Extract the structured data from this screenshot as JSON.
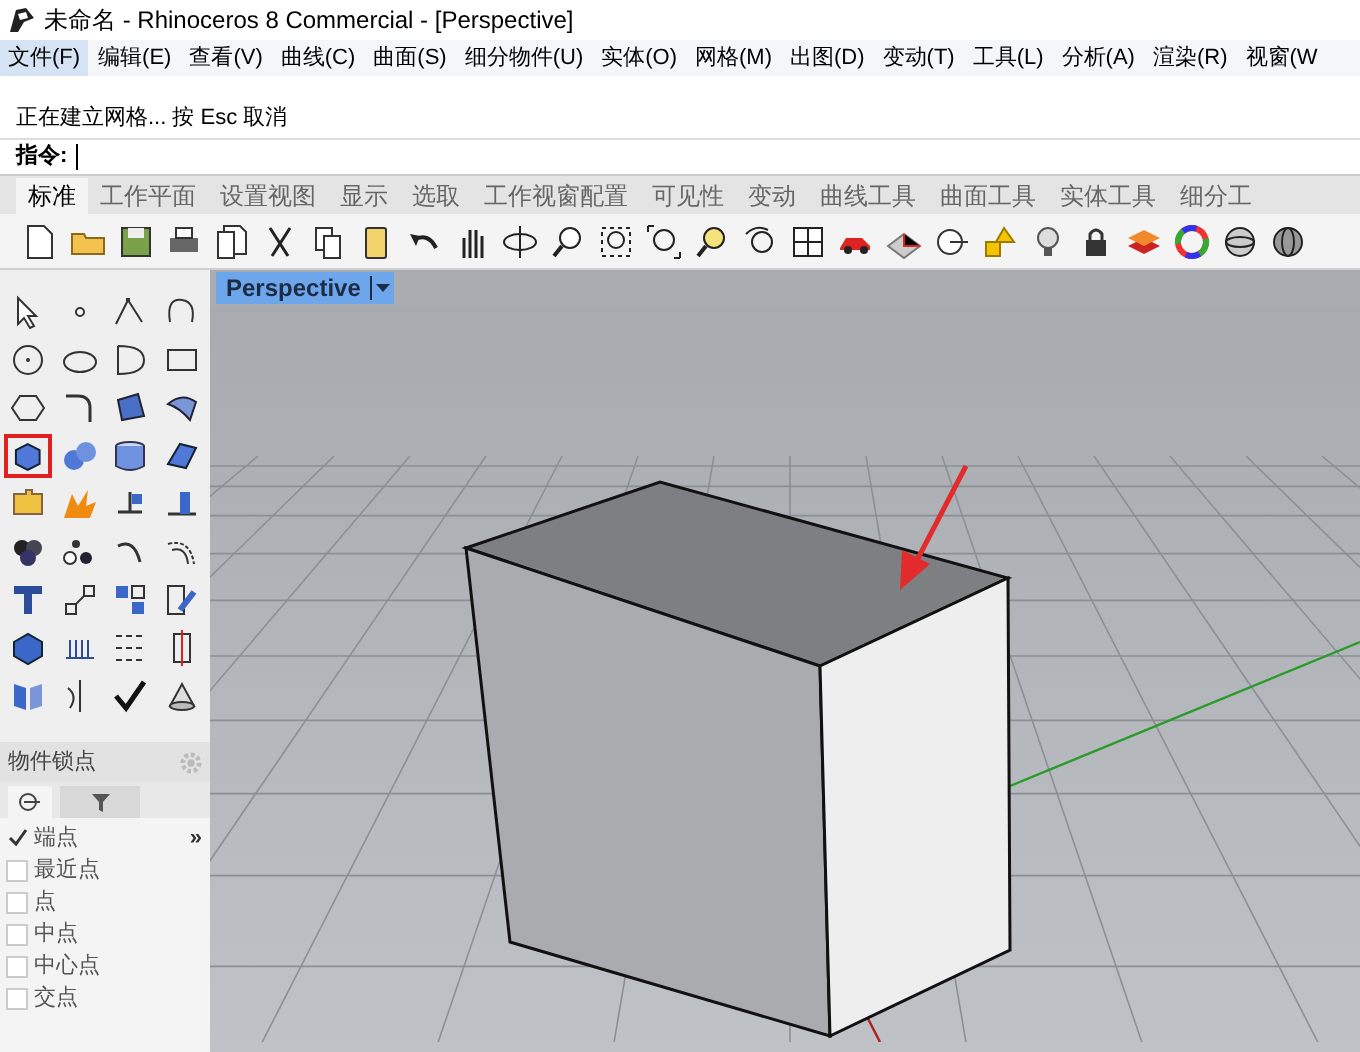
{
  "window": {
    "title": "未命名 - Rhinoceros 8 Commercial - [Perspective]"
  },
  "menu": [
    {
      "label": "文件(F)",
      "selected": true
    },
    {
      "label": "编辑(E)",
      "selected": false
    },
    {
      "label": "查看(V)",
      "selected": false
    },
    {
      "label": "曲线(C)",
      "selected": false
    },
    {
      "label": "曲面(S)",
      "selected": false
    },
    {
      "label": "细分物件(U)",
      "selected": false
    },
    {
      "label": "实体(O)",
      "selected": false
    },
    {
      "label": "网格(M)",
      "selected": false
    },
    {
      "label": "出图(D)",
      "selected": false
    },
    {
      "label": "变动(T)",
      "selected": false
    },
    {
      "label": "工具(L)",
      "selected": false
    },
    {
      "label": "分析(A)",
      "selected": false
    },
    {
      "label": "渲染(R)",
      "selected": false
    },
    {
      "label": "视窗(W",
      "selected": false
    }
  ],
  "command_history": [
    "正在建立网格... 按 Esc 取消"
  ],
  "command_prompt": {
    "label": "指令:"
  },
  "toolbar_tabs": [
    {
      "label": "标准",
      "selected": true
    },
    {
      "label": "工作平面",
      "selected": false
    },
    {
      "label": "设置视图",
      "selected": false
    },
    {
      "label": "显示",
      "selected": false
    },
    {
      "label": "选取",
      "selected": false
    },
    {
      "label": "工作视窗配置",
      "selected": false
    },
    {
      "label": "可见性",
      "selected": false
    },
    {
      "label": "变动",
      "selected": false
    },
    {
      "label": "曲线工具",
      "selected": false
    },
    {
      "label": "曲面工具",
      "selected": false
    },
    {
      "label": "实体工具",
      "selected": false
    },
    {
      "label": "细分工",
      "selected": false
    }
  ],
  "viewport": {
    "title": "Perspective"
  },
  "osnap": {
    "title": "物件锁点",
    "more": "»",
    "items": [
      {
        "label": "端点",
        "checked": true
      },
      {
        "label": "最近点",
        "checked": false
      },
      {
        "label": "点",
        "checked": false
      },
      {
        "label": "中点",
        "checked": false
      },
      {
        "label": "中心点",
        "checked": false
      },
      {
        "label": "交点",
        "checked": false
      }
    ]
  }
}
